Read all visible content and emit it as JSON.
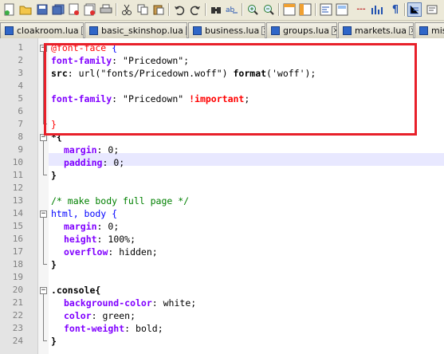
{
  "toolbar": {
    "icons": [
      "new-file-icon",
      "open-file-icon",
      "save-icon",
      "save-all-icon",
      "close-icon",
      "close-all-icon",
      "print-icon",
      "cut-icon",
      "copy-icon",
      "paste-icon",
      "undo-icon",
      "redo-icon",
      "find-icon",
      "replace-icon",
      "zoom-in-icon",
      "zoom-out-icon",
      "sync-vertical-icon",
      "sync-horizontal-icon",
      "word-wrap-icon",
      "show-all-chars-icon",
      "indent-guide-icon",
      "user-lang-icon"
    ]
  },
  "tabs": [
    {
      "label": "cloakroom.lua"
    },
    {
      "label": "basic_skinshop.lua"
    },
    {
      "label": "business.lua"
    },
    {
      "label": "groups.lua"
    },
    {
      "label": "markets.lua"
    },
    {
      "label": "miss"
    }
  ],
  "editor": {
    "line_numbers": [
      "1",
      "2",
      "3",
      "4",
      "5",
      "6",
      "7",
      "8",
      "9",
      "10",
      "11",
      "12",
      "13",
      "14",
      "15",
      "16",
      "17",
      "18",
      "19",
      "20",
      "21",
      "22",
      "23",
      "24"
    ],
    "lines": {
      "l1_at": "@font-face",
      "l1_brace": " {",
      "l2_prop": "font-family",
      "l2_rest": ": \"Pricedown\";",
      "l3_prop": "src",
      "l3_a": ": url(\"fonts/Pricedown.woff\") ",
      "l3_fn": "format",
      "l3_b": "('woff');",
      "l5_prop": "font-family",
      "l5_rest": ": \"Pricedown\" ",
      "l5_imp": "!important",
      "l5_end": ";",
      "l7": "}",
      "l8": "*{",
      "l9_prop": "margin",
      "l9_rest": ": 0;",
      "l10_prop": "padding",
      "l10_rest": ": 0;",
      "l11": "}",
      "l13": "/* make body full page */",
      "l14": "html, body {",
      "l15_prop": "margin",
      "l15_rest": ": 0;",
      "l16_prop": "height",
      "l16_rest": ": 100%;",
      "l17_prop": "overflow",
      "l17_rest": ": hidden;",
      "l18": "}",
      "l20": ".console{",
      "l21_prop": "background-color",
      "l21_rest": ": white;",
      "l22_prop": "color",
      "l22_rest": ": green;",
      "l23_prop": "font-weight",
      "l23_rest": ": bold;",
      "l24": "}"
    }
  },
  "colors": {
    "highlight_box": "#e8202a",
    "current_line": "#e8e8ff",
    "keyword_property": "#8000ff",
    "comment": "#008000",
    "important": "#ff0000"
  }
}
